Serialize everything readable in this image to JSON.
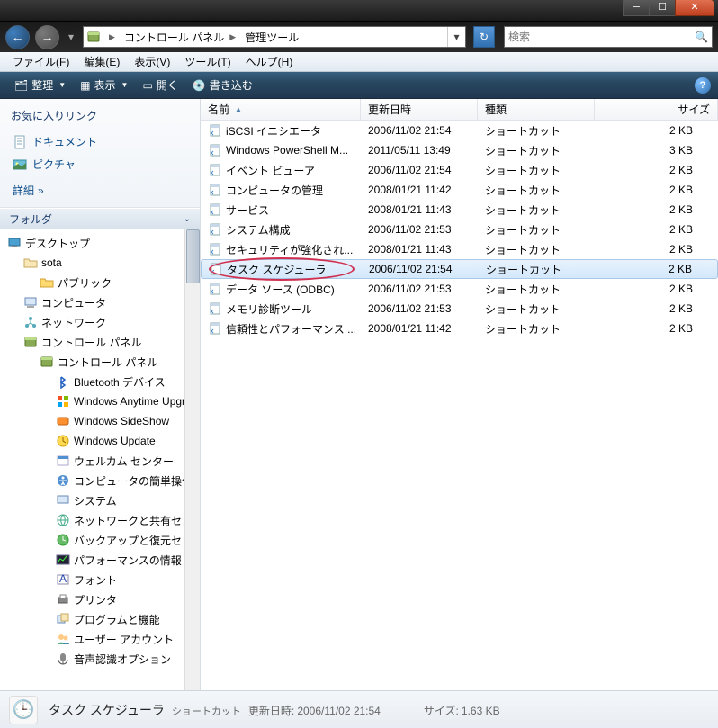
{
  "titlebar": {},
  "nav": {
    "breadcrumbs": [
      "コントロール パネル",
      "管理ツール"
    ],
    "search_placeholder": "検索"
  },
  "menubar": {
    "items": [
      "ファイル(F)",
      "編集(E)",
      "表示(V)",
      "ツール(T)",
      "ヘルプ(H)"
    ]
  },
  "toolbar": {
    "organize": "整理",
    "view": "表示",
    "open": "開く",
    "burn": "書き込む"
  },
  "favorites": {
    "title": "お気に入りリンク",
    "documents": "ドキュメント",
    "pictures": "ピクチャ",
    "more": "詳細"
  },
  "folders_header": "フォルダ",
  "tree": [
    {
      "indent": 0,
      "icon": "desktop",
      "label": "デスクトップ"
    },
    {
      "indent": 1,
      "icon": "folder",
      "label": "sota"
    },
    {
      "indent": 2,
      "icon": "folder-y",
      "label": "パブリック"
    },
    {
      "indent": 1,
      "icon": "computer",
      "label": "コンピュータ"
    },
    {
      "indent": 1,
      "icon": "network",
      "label": "ネットワーク"
    },
    {
      "indent": 1,
      "icon": "panel",
      "label": "コントロール パネル"
    },
    {
      "indent": 2,
      "icon": "panel",
      "label": "コントロール パネル"
    },
    {
      "indent": 3,
      "icon": "bt",
      "label": "Bluetooth デバイス"
    },
    {
      "indent": 3,
      "icon": "win",
      "label": "Windows Anytime Upgr"
    },
    {
      "indent": 3,
      "icon": "sideshow",
      "label": "Windows SideShow"
    },
    {
      "indent": 3,
      "icon": "update",
      "label": "Windows Update"
    },
    {
      "indent": 3,
      "icon": "welcome",
      "label": "ウェルカム センター"
    },
    {
      "indent": 3,
      "icon": "ease",
      "label": "コンピュータの簡単操作セ"
    },
    {
      "indent": 3,
      "icon": "system",
      "label": "システム"
    },
    {
      "indent": 3,
      "icon": "netshare",
      "label": "ネットワークと共有セン"
    },
    {
      "indent": 3,
      "icon": "backup",
      "label": "バックアップと復元セン"
    },
    {
      "indent": 3,
      "icon": "perf",
      "label": "パフォーマンスの情報とツ"
    },
    {
      "indent": 3,
      "icon": "font",
      "label": "フォント"
    },
    {
      "indent": 3,
      "icon": "printer",
      "label": "プリンタ"
    },
    {
      "indent": 3,
      "icon": "prog",
      "label": "プログラムと機能"
    },
    {
      "indent": 3,
      "icon": "users",
      "label": "ユーザー アカウント"
    },
    {
      "indent": 3,
      "icon": "speech",
      "label": "音声認識オプション"
    }
  ],
  "columns": {
    "name": "名前",
    "date": "更新日時",
    "type": "種類",
    "size": "サイズ"
  },
  "files": [
    {
      "name": "iSCSI イニシエータ",
      "date": "2006/11/02 21:54",
      "type": "ショートカット",
      "size": "2 KB",
      "selected": false
    },
    {
      "name": "Windows PowerShell M...",
      "date": "2011/05/11 13:49",
      "type": "ショートカット",
      "size": "3 KB",
      "selected": false
    },
    {
      "name": "イベント ビューア",
      "date": "2006/11/02 21:54",
      "type": "ショートカット",
      "size": "2 KB",
      "selected": false
    },
    {
      "name": "コンピュータの管理",
      "date": "2008/01/21 11:42",
      "type": "ショートカット",
      "size": "2 KB",
      "selected": false
    },
    {
      "name": "サービス",
      "date": "2008/01/21 11:43",
      "type": "ショートカット",
      "size": "2 KB",
      "selected": false
    },
    {
      "name": "システム構成",
      "date": "2006/11/02 21:53",
      "type": "ショートカット",
      "size": "2 KB",
      "selected": false
    },
    {
      "name": "セキュリティが強化され...",
      "date": "2008/01/21 11:43",
      "type": "ショートカット",
      "size": "2 KB",
      "selected": false
    },
    {
      "name": "タスク スケジューラ",
      "date": "2006/11/02 21:54",
      "type": "ショートカット",
      "size": "2 KB",
      "selected": true,
      "circled": true
    },
    {
      "name": "データ ソース (ODBC)",
      "date": "2006/11/02 21:53",
      "type": "ショートカット",
      "size": "2 KB",
      "selected": false
    },
    {
      "name": "メモリ診断ツール",
      "date": "2006/11/02 21:53",
      "type": "ショートカット",
      "size": "2 KB",
      "selected": false
    },
    {
      "name": "信頼性とパフォーマンス ...",
      "date": "2008/01/21 11:42",
      "type": "ショートカット",
      "size": "2 KB",
      "selected": false
    }
  ],
  "status": {
    "title": "タスク スケジューラ",
    "type": "ショートカット",
    "date_label": "更新日時:",
    "date": "2006/11/02 21:54",
    "size_label": "サイズ:",
    "size": "1.63 KB"
  }
}
